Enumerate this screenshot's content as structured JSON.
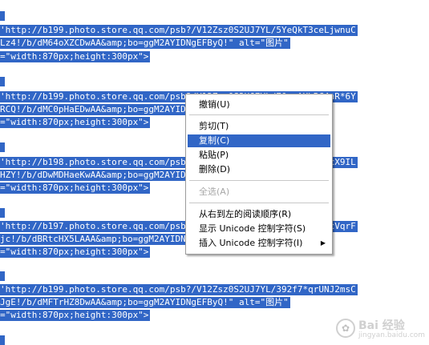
{
  "editor": {
    "lines": [
      "'http://b199.photo.store.qq.com/psb?/V12Zsz0S2UJ7YL/5YeQkT3ceLjwnuC",
      "Lz4!/b/dM64oXZCDwAA&amp;bo=ggM2AYIDNgEFByQ!\" alt=\"图片\"",
      "=\"width:870px;height:300px\">",
      "'http://b199.photo.store.qq.com/psb?/V12Zsz0S2UJ7YL/70noAXbBC4aR*6Y",
      "RCQ!/b/dMC0pHaEDwAA&amp;bo=ggM2AYIDNgEFByQ!\" alt=\"图片\"",
      "=\"width:870px;height:300px\">",
      "'http://b198.photo.store.qq.com/psb?/V12Zsz0S2UJ7YL/dZ*Hh2IFcycX9IL",
      "HZY!/b/dDwMDHaeKwAA&amp;bo=ggM2AYIDNgEFByQ!\" alt=\"图片\"",
      "=\"width:870px;height:300px\">",
      "'http://b197.photo.store.qq.com/psb?/V12Zsz0S2UJ7YL/jV5*wH4eDicVqrF",
      "jc!/b/dBRtcHX5LAAA&amp;bo=ggM2AYIDNgEFByQ!\" alt=\"图片\"",
      "=\"width:870px;height:300px\">",
      "'http://b199.photo.store.qq.com/psb?/V12Zsz0S2UJ7YL/392f7*qrUNJ2msC",
      "JgE!/b/dMFTrHZ8DwAA&amp;bo=ggM2AYIDNgEFByQ!\" alt=\"图片\"",
      "=\"width:870px;height:300px\">"
    ]
  },
  "context_menu": {
    "items": [
      {
        "label": "撤销(U)",
        "state": "normal"
      },
      {
        "label": "剪切(T)",
        "state": "normal"
      },
      {
        "label": "复制(C)",
        "state": "highlighted"
      },
      {
        "label": "粘贴(P)",
        "state": "normal"
      },
      {
        "label": "删除(D)",
        "state": "normal"
      },
      {
        "label": "全选(A)",
        "state": "disabled"
      },
      {
        "label": "从右到左的阅读顺序(R)",
        "state": "normal"
      },
      {
        "label": "显示 Unicode 控制字符(S)",
        "state": "normal"
      },
      {
        "label": "插入 Unicode 控制字符(I)",
        "state": "normal",
        "arrow": "▶"
      }
    ]
  },
  "watermark": {
    "brand": "Bai 经验",
    "url": "jingyan.baidu.com"
  },
  "colors": {
    "selection": "#3166c6",
    "disabled": "#a7a7a7"
  }
}
